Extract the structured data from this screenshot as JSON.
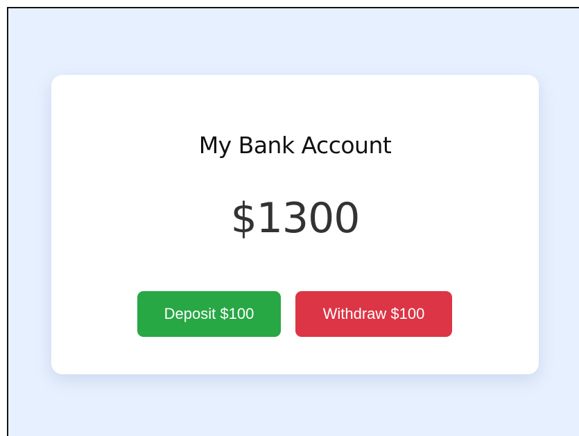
{
  "account": {
    "title": "My Bank Account",
    "balance": "$1300"
  },
  "actions": {
    "deposit_label": "Deposit $100",
    "withdraw_label": "Withdraw $100"
  },
  "colors": {
    "background": "#e7f0fe",
    "card": "#ffffff",
    "deposit": "#28a745",
    "withdraw": "#dc3545"
  }
}
